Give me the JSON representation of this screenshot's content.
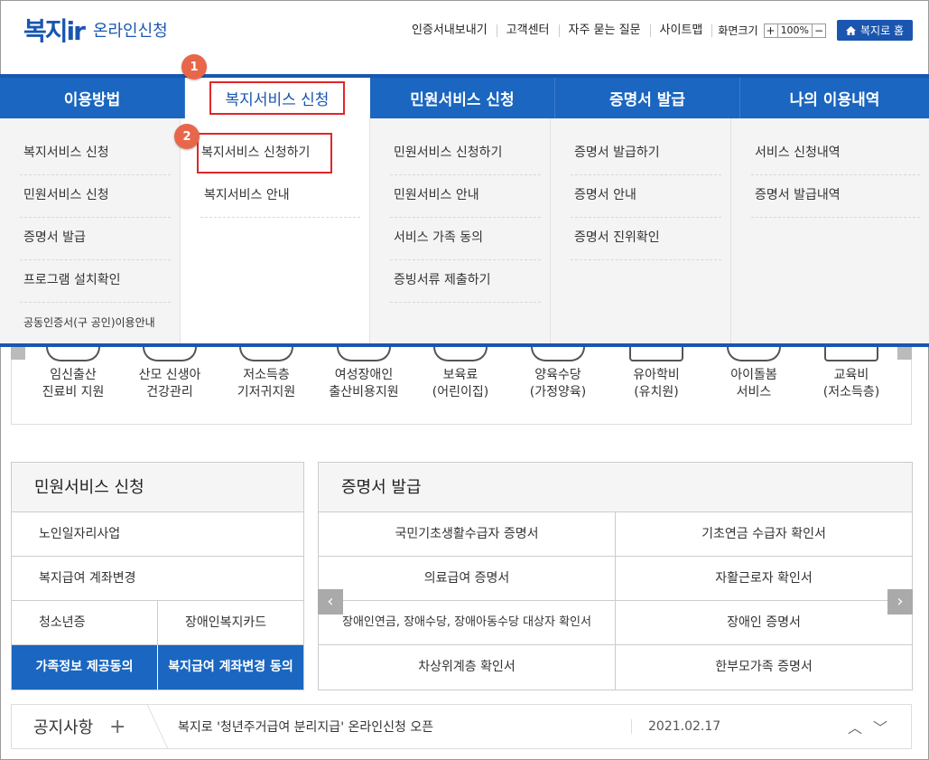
{
  "header": {
    "logo_mark": "복지ir",
    "logo_sub": "온라인신청",
    "util_links": [
      "인증서내보내기",
      "고객센터",
      "자주 묻는 질문",
      "사이트맵"
    ],
    "screen_size_label": "화면크기",
    "zoom_plus": "+",
    "zoom_value": "100%",
    "zoom_minus": "−",
    "home_button": "복지로 홈"
  },
  "gnb": {
    "tabs": [
      "이용방법",
      "복지서비스 신청",
      "민원서비스 신청",
      "증명서 발급",
      "나의 이용내역"
    ],
    "active_index": 1
  },
  "mega_menu": {
    "col1": [
      "복지서비스 신청",
      "민원서비스 신청",
      "증명서 발급",
      "프로그램 설치확인",
      "공동인증서(구 공인)이용안내"
    ],
    "col2": [
      "복지서비스 신청하기",
      "복지서비스 안내"
    ],
    "col3": [
      "민원서비스 신청하기",
      "민원서비스 안내",
      "서비스 가족 동의",
      "증빙서류 제출하기"
    ],
    "col4": [
      "증명서 발급하기",
      "증명서 안내",
      "증명서 진위확인"
    ],
    "col5": [
      "서비스 신청내역",
      "증명서 발급내역"
    ]
  },
  "badges": [
    "1",
    "2"
  ],
  "services": [
    [
      "임신출산",
      "진료비 지원"
    ],
    [
      "산모 신생아",
      "건강관리"
    ],
    [
      "저소득층",
      "기저귀지원"
    ],
    [
      "여성장애인",
      "출산비용지원"
    ],
    [
      "보육료",
      "(어린이집)"
    ],
    [
      "양육수당",
      "(가정양육)"
    ],
    [
      "유아학비",
      "(유치원)"
    ],
    [
      "아이돌봄",
      "서비스"
    ],
    [
      "교육비",
      "(저소득층)"
    ]
  ],
  "civil": {
    "title": "민원서비스 신청",
    "rows": [
      "노인일자리사업",
      "복지급여 계좌변경"
    ],
    "half": [
      "청소년증",
      "장애인복지카드"
    ],
    "buttons": [
      "가족정보 제공동의",
      "복지급여 계좌변경 동의"
    ]
  },
  "cert": {
    "title": "증명서 발급",
    "cells": [
      "국민기초생활수급자 증명서",
      "기초연금 수급자 확인서",
      "의료급여 증명서",
      "자활근로자 확인서",
      "장애인연금, 장애수당, 장애아동수당 대상자 확인서",
      "장애인 증명서",
      "차상위계층 확인서",
      "한부모가족 증명서"
    ],
    "prev": "‹",
    "next": "›"
  },
  "notice": {
    "label": "공지사항",
    "plus": "+",
    "text": "복지로 '청년주거급여 분리지급' 온라인신청 오픈",
    "date": "2021.02.17",
    "nav": "︿﹀"
  },
  "colors": {
    "primary": "#1a66c0",
    "highlight": "#e0262b",
    "badge": "#e8674a"
  }
}
